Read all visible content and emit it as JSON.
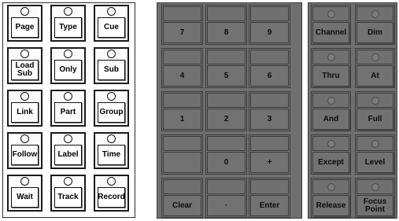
{
  "left_panel": {
    "keys": [
      [
        "Page",
        "Type",
        "Cue"
      ],
      [
        "Load\nSub",
        "Only",
        "Sub"
      ],
      [
        "Link",
        "Part",
        "Group"
      ],
      [
        "Follow",
        "Label",
        "Time"
      ],
      [
        "Wait",
        "Track",
        "Record"
      ]
    ]
  },
  "number_panel": {
    "keys": [
      [
        "7",
        "8",
        "9"
      ],
      [
        "4",
        "5",
        "6"
      ],
      [
        "1",
        "2",
        "3"
      ],
      [
        "",
        "0",
        "+"
      ],
      [
        "Clear",
        "·",
        "Enter"
      ]
    ]
  },
  "function_panel": {
    "keys": [
      [
        "Channel",
        "Dim"
      ],
      [
        "Thru",
        "At"
      ],
      [
        "And",
        "Full"
      ],
      [
        "Except",
        "Level"
      ],
      [
        "Release",
        "Focus\nPoint"
      ]
    ]
  },
  "colors": {
    "left_bg": "#ffffff",
    "panel_grey": "#6f6f6f",
    "text_dark": "#0c0c0c"
  }
}
